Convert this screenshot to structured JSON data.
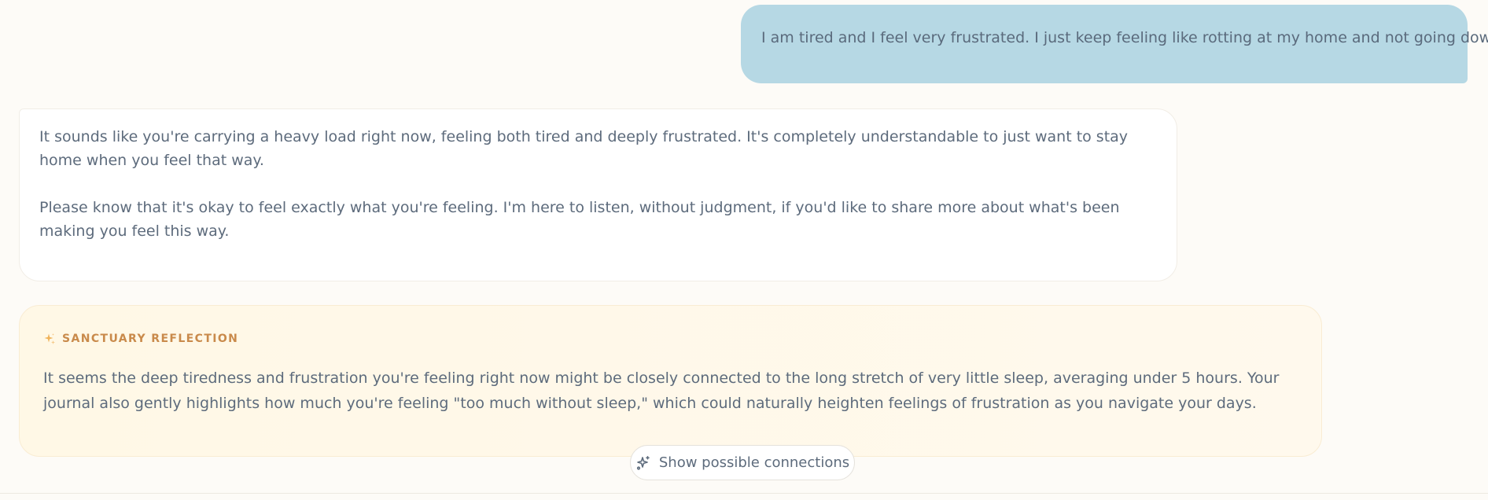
{
  "conversation": {
    "user_message": "I am tired and I feel very frustrated. I just keep feeling like rotting at my home and not going down.",
    "assistant_paragraphs": [
      "It sounds like you're carrying a heavy load right now, feeling both tired and deeply frustrated. It's completely understandable to just want to stay home when you feel that way.",
      "Please know that it's okay to feel exactly what you're feeling. I'm here to listen, without judgment, if you'd like to share more about what's been making you feel this way."
    ]
  },
  "reflection": {
    "icon": "sparkle-icon",
    "title": "SANCTUARY REFLECTION",
    "text": "It seems the deep tiredness and frustration you're feeling right now might be closely connected to the long stretch of very little sleep, averaging under 5 hours. Your journal also gently highlights how much you're feeling \"too much without sleep,\" which could naturally heighten feelings of frustration as you navigate your days."
  },
  "connections_button": {
    "icon": "sparkles-icon",
    "label": "Show possible connections"
  },
  "colors": {
    "background": "#fdfbf7",
    "user_bubble": "#b6d8e4",
    "assistant_bubble": "#ffffff",
    "reflection_background": "#fff8e6",
    "reflection_accent": "#c98a4b",
    "text": "#5d6b7c"
  }
}
